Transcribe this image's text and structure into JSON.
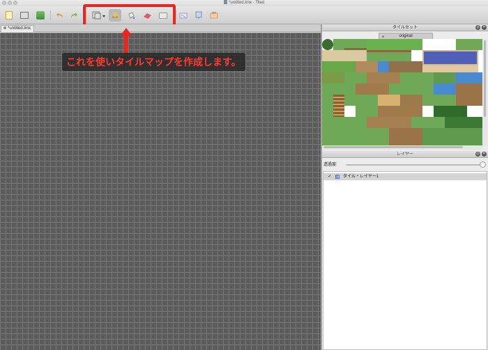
{
  "window": {
    "title": "*untitled.tmx - Tiled"
  },
  "toolbar": {
    "items": [
      {
        "name": "new-document-icon",
        "color": "#e8c44a"
      },
      {
        "name": "open-document-icon",
        "color": "#707070"
      },
      {
        "name": "save-icon",
        "color": "#3f8e3a"
      },
      {
        "name": "undo-icon",
        "color": "#d9a030"
      },
      {
        "name": "redo-icon",
        "color": "#8fb44a"
      },
      {
        "name": "random-mode-icon",
        "color": "#707070"
      },
      {
        "name": "stamp-brush-icon",
        "color": "#c8a020"
      },
      {
        "name": "bucket-fill-icon",
        "color": "#8a8a8a"
      },
      {
        "name": "eraser-icon",
        "color": "#e05a6a"
      },
      {
        "name": "rect-select-icon",
        "color": "#9a9a9a"
      },
      {
        "name": "magic-wand-icon",
        "color": "#9a9aca"
      },
      {
        "name": "select-same-tile-icon",
        "color": "#7a8fb8"
      },
      {
        "name": "object-icon",
        "color": "#d8a060"
      }
    ],
    "highlight_color": "#e8281e"
  },
  "map_tab": {
    "label": "*untitled.tmx"
  },
  "annotation": {
    "text": "これを使いタイルマップを作成します。",
    "color": "#ff3b30"
  },
  "tileset_panel": {
    "title": "タイルセット",
    "tab_label": "original"
  },
  "layers_panel": {
    "title": "レイヤー",
    "opacity_label": "透過度:",
    "opacity_value": 1.0,
    "layers": [
      {
        "visible": true,
        "name": "タイル・レイヤー1"
      }
    ]
  }
}
